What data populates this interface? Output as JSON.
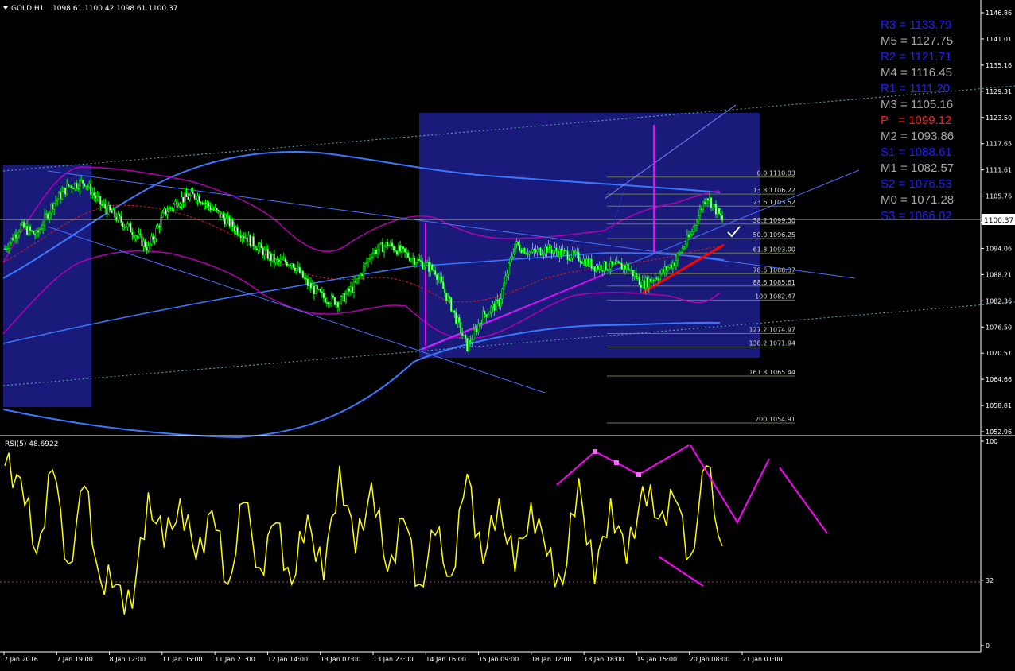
{
  "header": {
    "symbol": "GOLD,H1",
    "ohlc": "1098.61 1100.42 1098.61 1100.37"
  },
  "rsi_header": {
    "label": "RSI(5) 48.6922"
  },
  "price_marker": "1100.37",
  "colors": {
    "background": "#000000",
    "candle": "#00ff00",
    "rectangle": "#1a1a7a",
    "bollinger": "#c000c0",
    "envelope": "#3a78ff",
    "rsi_line": "#ffff00",
    "pivot_blue": "#2020ff",
    "pivot_gray": "#a8a8a8",
    "pivot_red": "#ff2020",
    "annotation_magenta": "#ff00ff",
    "trend_red": "#ff0000"
  },
  "pivots": [
    {
      "label": "R3 = 1133.79",
      "kind": "blue"
    },
    {
      "label": "M5 = 1127.75",
      "kind": "gray"
    },
    {
      "label": "R2 = 1121.71",
      "kind": "blue"
    },
    {
      "label": "M4 = 1116.45",
      "kind": "gray"
    },
    {
      "label": "R1 = 1111.20",
      "kind": "blue"
    },
    {
      "label": "M3 = 1105.16",
      "kind": "gray"
    },
    {
      "label": "P   = 1099.12",
      "kind": "red"
    },
    {
      "label": "M2 = 1093.86",
      "kind": "gray"
    },
    {
      "label": "S1 = 1088.61",
      "kind": "blue"
    },
    {
      "label": "M1 = 1082.57",
      "kind": "gray"
    },
    {
      "label": "S2 = 1076.53",
      "kind": "blue"
    },
    {
      "label": "M0 = 1071.28",
      "kind": "gray"
    },
    {
      "label": "S3 = 1066.02",
      "kind": "blue"
    }
  ],
  "fibonacci": [
    {
      "label": "0.0 1110.03",
      "price": 1110.03
    },
    {
      "label": "13.8 1106.22",
      "price": 1106.22
    },
    {
      "label": "23.6 1103.52",
      "price": 1103.52
    },
    {
      "label": "38.2 1099.50",
      "price": 1099.5
    },
    {
      "label": "50.0 1096.25",
      "price": 1096.25
    },
    {
      "label": "61.8 1093.00",
      "price": 1093.0
    },
    {
      "label": "78.6 1088.37",
      "price": 1088.37
    },
    {
      "label": "88.6 1085.61",
      "price": 1085.61
    },
    {
      "label": "100 1082.47",
      "price": 1082.47
    },
    {
      "label": "127.2 1074.97",
      "price": 1074.97
    },
    {
      "label": "138.2 1071.94",
      "price": 1071.94
    },
    {
      "label": "161.8 1065.44",
      "price": 1065.44
    },
    {
      "label": "200 1054.91",
      "price": 1054.91
    }
  ],
  "chart_data": {
    "type": "line",
    "title": "GOLD,H1",
    "price_axis": {
      "ticks": [
        "1146.86",
        "1141.01",
        "1135.16",
        "1129.31",
        "1123.50",
        "1117.65",
        "1111.61",
        "1105.76",
        "1099.91",
        "1094.06",
        "1088.21",
        "1082.36",
        "1076.50",
        "1070.51",
        "1064.66",
        "1058.81",
        "1052.96"
      ],
      "ylim": [
        1052.96,
        1146.86
      ]
    },
    "x_ticks": [
      "7 Jan 2016",
      "7 Jan 19:00",
      "8 Jan 12:00",
      "11 Jan 05:00",
      "11 Jan 21:00",
      "12 Jan 14:00",
      "13 Jan 07:00",
      "13 Jan 23:00",
      "14 Jan 16:00",
      "15 Jan 09:00",
      "18 Jan 02:00",
      "18 Jan 18:00",
      "19 Jan 15:00",
      "20 Jan 08:00",
      "21 Jan 01:00"
    ],
    "price_series": {
      "name": "GOLD,H1",
      "bar_index": [
        0,
        10,
        20,
        30,
        40,
        50,
        60,
        70,
        80,
        90,
        100,
        110,
        120,
        130,
        140,
        150,
        160,
        170,
        180,
        190,
        200,
        210,
        220,
        230,
        240,
        250,
        260,
        270,
        280,
        290,
        300,
        310,
        320,
        330,
        340,
        350,
        360,
        370,
        380,
        390,
        400,
        410,
        420,
        430,
        440,
        450
      ],
      "close": [
        1094,
        1099,
        1097,
        1104,
        1108,
        1109,
        1104,
        1101,
        1098,
        1094,
        1102,
        1105,
        1106,
        1103,
        1100,
        1097,
        1094,
        1091,
        1091,
        1086,
        1083,
        1082,
        1086,
        1093,
        1095,
        1093,
        1091,
        1089,
        1081,
        1072,
        1079,
        1082,
        1095,
        1093,
        1094,
        1093,
        1092,
        1090,
        1090,
        1090,
        1086,
        1088,
        1091,
        1097,
        1106,
        1100.37
      ]
    },
    "rsi": {
      "name": "RSI(5)",
      "last": 48.6922,
      "ylim": [
        0,
        100
      ],
      "ticks": [
        "100",
        "32",
        "0"
      ],
      "level": 32,
      "bar_index": [
        0,
        10,
        20,
        30,
        40,
        50,
        60,
        70,
        80,
        90,
        100,
        110,
        120,
        130,
        140,
        150,
        160,
        170,
        180,
        190,
        200,
        210,
        220,
        230,
        240,
        250,
        260,
        270,
        280,
        290,
        300,
        310,
        320,
        330,
        340,
        350,
        360,
        370,
        380,
        390,
        400,
        410,
        420,
        430,
        440,
        450
      ],
      "values": [
        88,
        82,
        45,
        86,
        40,
        78,
        32,
        30,
        18,
        75,
        48,
        72,
        42,
        66,
        30,
        70,
        38,
        60,
        30,
        64,
        32,
        88,
        45,
        80,
        36,
        62,
        30,
        54,
        34,
        84,
        40,
        72,
        36,
        70,
        44,
        30,
        82,
        30,
        72,
        40,
        78,
        62,
        72,
        44,
        88,
        48.69
      ]
    }
  }
}
